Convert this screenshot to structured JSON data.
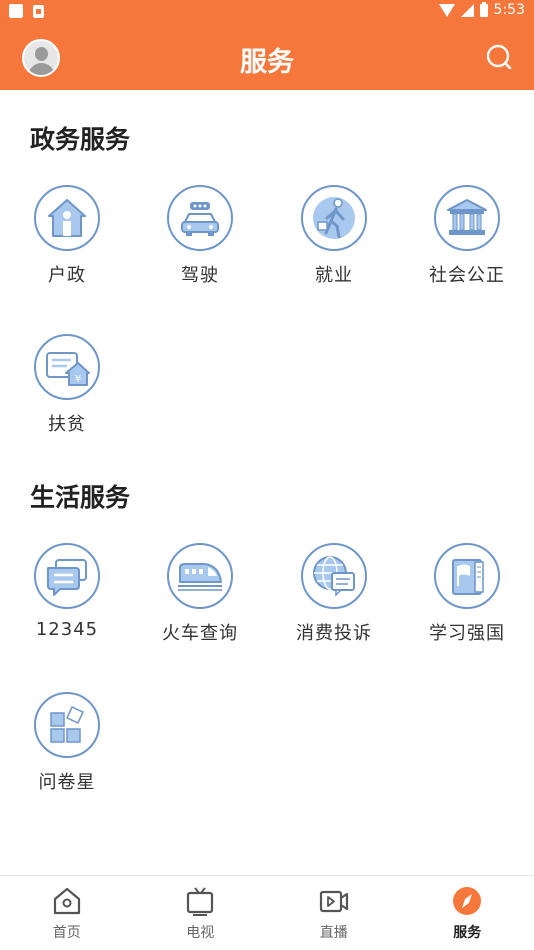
{
  "status_bar": {
    "time": "5:53"
  },
  "header": {
    "title": "服务"
  },
  "sections": [
    {
      "title": "政务服务",
      "items": [
        {
          "label": "户政",
          "icon": "household-icon"
        },
        {
          "label": "驾驶",
          "icon": "car-icon"
        },
        {
          "label": "就业",
          "icon": "employment-icon"
        },
        {
          "label": "社会公正",
          "icon": "courthouse-icon"
        },
        {
          "label": "扶贫",
          "icon": "poverty-relief-icon"
        }
      ]
    },
    {
      "title": "生活服务",
      "items": [
        {
          "label": "12345",
          "icon": "hotline-chat-icon"
        },
        {
          "label": "火车查询",
          "icon": "train-icon"
        },
        {
          "label": "消费投诉",
          "icon": "consumer-complaint-icon"
        },
        {
          "label": "学习强国",
          "icon": "study-book-icon"
        },
        {
          "label": "问卷星",
          "icon": "questionnaire-blocks-icon"
        }
      ]
    }
  ],
  "bottom_nav": [
    {
      "label": "首页",
      "icon": "home-icon"
    },
    {
      "label": "电视",
      "icon": "tv-icon"
    },
    {
      "label": "直播",
      "icon": "live-video-icon"
    },
    {
      "label": "服务",
      "icon": "compass-icon",
      "active": true
    }
  ],
  "colors": {
    "accent": "#f5773b",
    "icon_blue": "#6f96c9",
    "icon_fill": "#a9c8ee"
  }
}
